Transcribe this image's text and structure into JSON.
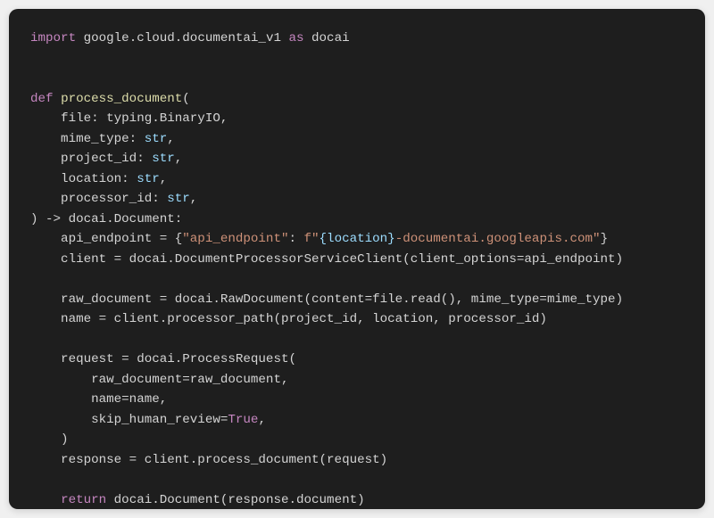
{
  "code": {
    "lines": [
      [
        {
          "cls": "t-keyword",
          "text": "import"
        },
        {
          "cls": "t-white",
          "text": " google.cloud.documentai_v1 "
        },
        {
          "cls": "t-keyword",
          "text": "as"
        },
        {
          "cls": "t-white",
          "text": " docai"
        }
      ],
      [],
      [],
      [
        {
          "cls": "t-keyword",
          "text": "def"
        },
        {
          "cls": "t-white",
          "text": " "
        },
        {
          "cls": "t-funcname",
          "text": "process_document"
        },
        {
          "cls": "t-white",
          "text": "("
        }
      ],
      [
        {
          "cls": "t-white",
          "text": "    file: typing.BinaryIO,"
        }
      ],
      [
        {
          "cls": "t-white",
          "text": "    mime_type: "
        },
        {
          "cls": "t-builtin",
          "text": "str"
        },
        {
          "cls": "t-white",
          "text": ","
        }
      ],
      [
        {
          "cls": "t-white",
          "text": "    project_id: "
        },
        {
          "cls": "t-builtin",
          "text": "str"
        },
        {
          "cls": "t-white",
          "text": ","
        }
      ],
      [
        {
          "cls": "t-white",
          "text": "    location: "
        },
        {
          "cls": "t-builtin",
          "text": "str"
        },
        {
          "cls": "t-white",
          "text": ","
        }
      ],
      [
        {
          "cls": "t-white",
          "text": "    processor_id: "
        },
        {
          "cls": "t-builtin",
          "text": "str"
        },
        {
          "cls": "t-white",
          "text": ","
        }
      ],
      [
        {
          "cls": "t-white",
          "text": ") -> docai.Document:"
        }
      ],
      [
        {
          "cls": "t-white",
          "text": "    api_endpoint = {"
        },
        {
          "cls": "t-string",
          "text": "\"api_endpoint\""
        },
        {
          "cls": "t-white",
          "text": ": "
        },
        {
          "cls": "t-string",
          "text": "f\""
        },
        {
          "cls": "t-fexpr",
          "text": "{location}"
        },
        {
          "cls": "t-string",
          "text": "-documentai.googleapis.com\""
        },
        {
          "cls": "t-white",
          "text": "}"
        }
      ],
      [
        {
          "cls": "t-white",
          "text": "    client = docai.DocumentProcessorServiceClient(client_options=api_endpoint)"
        }
      ],
      [],
      [
        {
          "cls": "t-white",
          "text": "    raw_document = docai.RawDocument(content=file.read(), mime_type=mime_type)"
        }
      ],
      [
        {
          "cls": "t-white",
          "text": "    name = client.processor_path(project_id, location, processor_id)"
        }
      ],
      [],
      [
        {
          "cls": "t-white",
          "text": "    request = docai.ProcessRequest("
        }
      ],
      [
        {
          "cls": "t-white",
          "text": "        raw_document=raw_document,"
        }
      ],
      [
        {
          "cls": "t-white",
          "text": "        name=name,"
        }
      ],
      [
        {
          "cls": "t-white",
          "text": "        skip_human_review="
        },
        {
          "cls": "t-bool",
          "text": "True"
        },
        {
          "cls": "t-white",
          "text": ","
        }
      ],
      [
        {
          "cls": "t-white",
          "text": "    )"
        }
      ],
      [
        {
          "cls": "t-white",
          "text": "    response = client.process_document(request)"
        }
      ],
      [],
      [
        {
          "cls": "t-white",
          "text": "    "
        },
        {
          "cls": "t-keyword",
          "text": "return"
        },
        {
          "cls": "t-white",
          "text": " docai.Document(response.document)"
        }
      ]
    ]
  }
}
